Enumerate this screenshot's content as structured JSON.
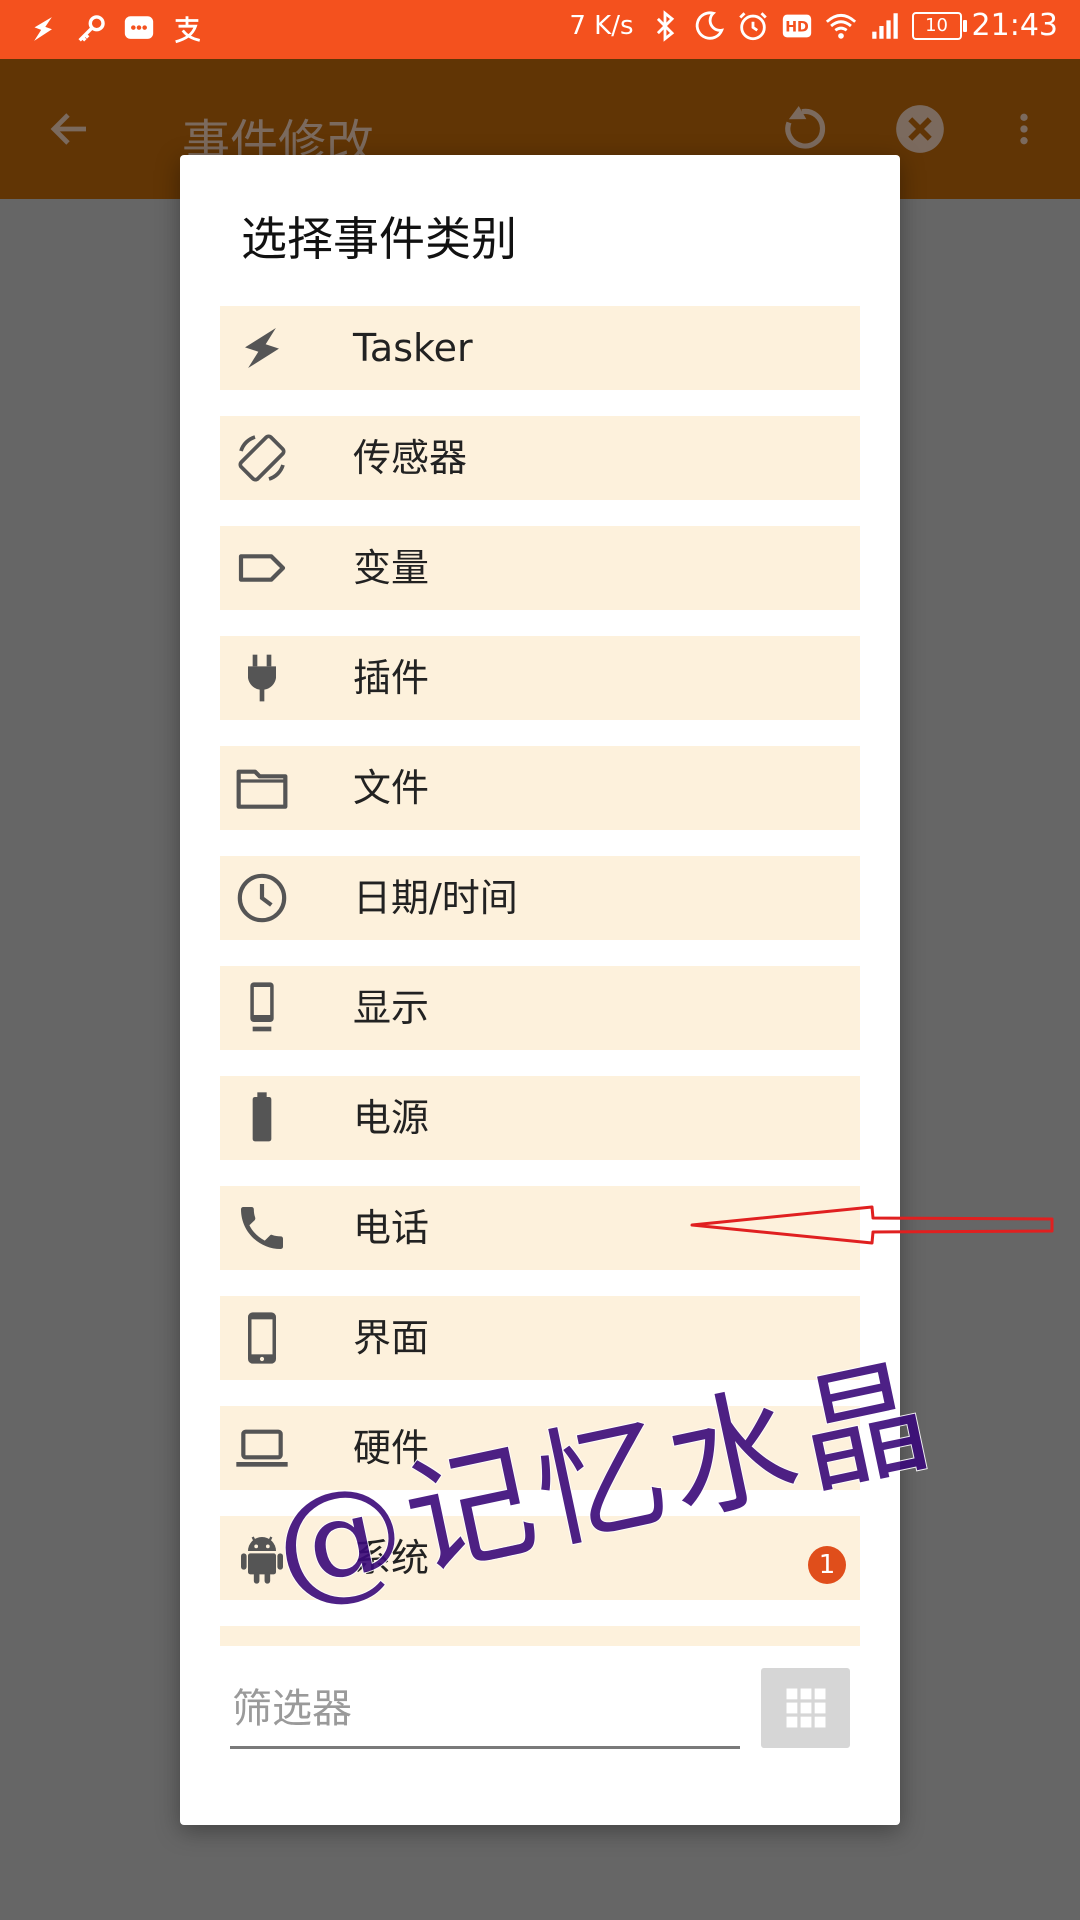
{
  "status_bar": {
    "net_speed": "7 K/s",
    "battery_level": "10",
    "time": "21:43",
    "left_icons": [
      "tasker-bolt-icon",
      "key-icon",
      "chat-bubble-icon",
      "alipay-icon"
    ],
    "right_icons": [
      "bluetooth-icon",
      "moon-icon",
      "alarm-icon",
      "hd-icon",
      "wifi-icon",
      "signal-icon",
      "battery-icon"
    ],
    "background_color": "#F4511E"
  },
  "app_bar": {
    "title": "事件修改",
    "background_color": "#613505"
  },
  "dialog": {
    "title": "选择事件类别",
    "items": [
      {
        "label": "Tasker",
        "icon": "bolt-icon"
      },
      {
        "label": "传感器",
        "icon": "screen-rotation-icon"
      },
      {
        "label": "变量",
        "icon": "tag-icon"
      },
      {
        "label": "插件",
        "icon": "plug-icon"
      },
      {
        "label": "文件",
        "icon": "folder-icon"
      },
      {
        "label": "日期/时间",
        "icon": "clock-icon"
      },
      {
        "label": "显示",
        "icon": "dock-phone-icon"
      },
      {
        "label": "电源",
        "icon": "battery-icon"
      },
      {
        "label": "电话",
        "icon": "phone-icon"
      },
      {
        "label": "界面",
        "icon": "smartphone-icon"
      },
      {
        "label": "硬件",
        "icon": "laptop-icon"
      },
      {
        "label": "系统",
        "icon": "android-icon",
        "badge": "1"
      }
    ],
    "item_background": "#FDF1DC",
    "filter": {
      "placeholder": "筛选器",
      "value": ""
    },
    "grid_button_icon": "grid-view-icon"
  },
  "watermark": {
    "text": "@记忆水晶",
    "color": "#3a0a7a"
  },
  "annotation": {
    "type": "red-arrow",
    "color": "#E02020"
  }
}
